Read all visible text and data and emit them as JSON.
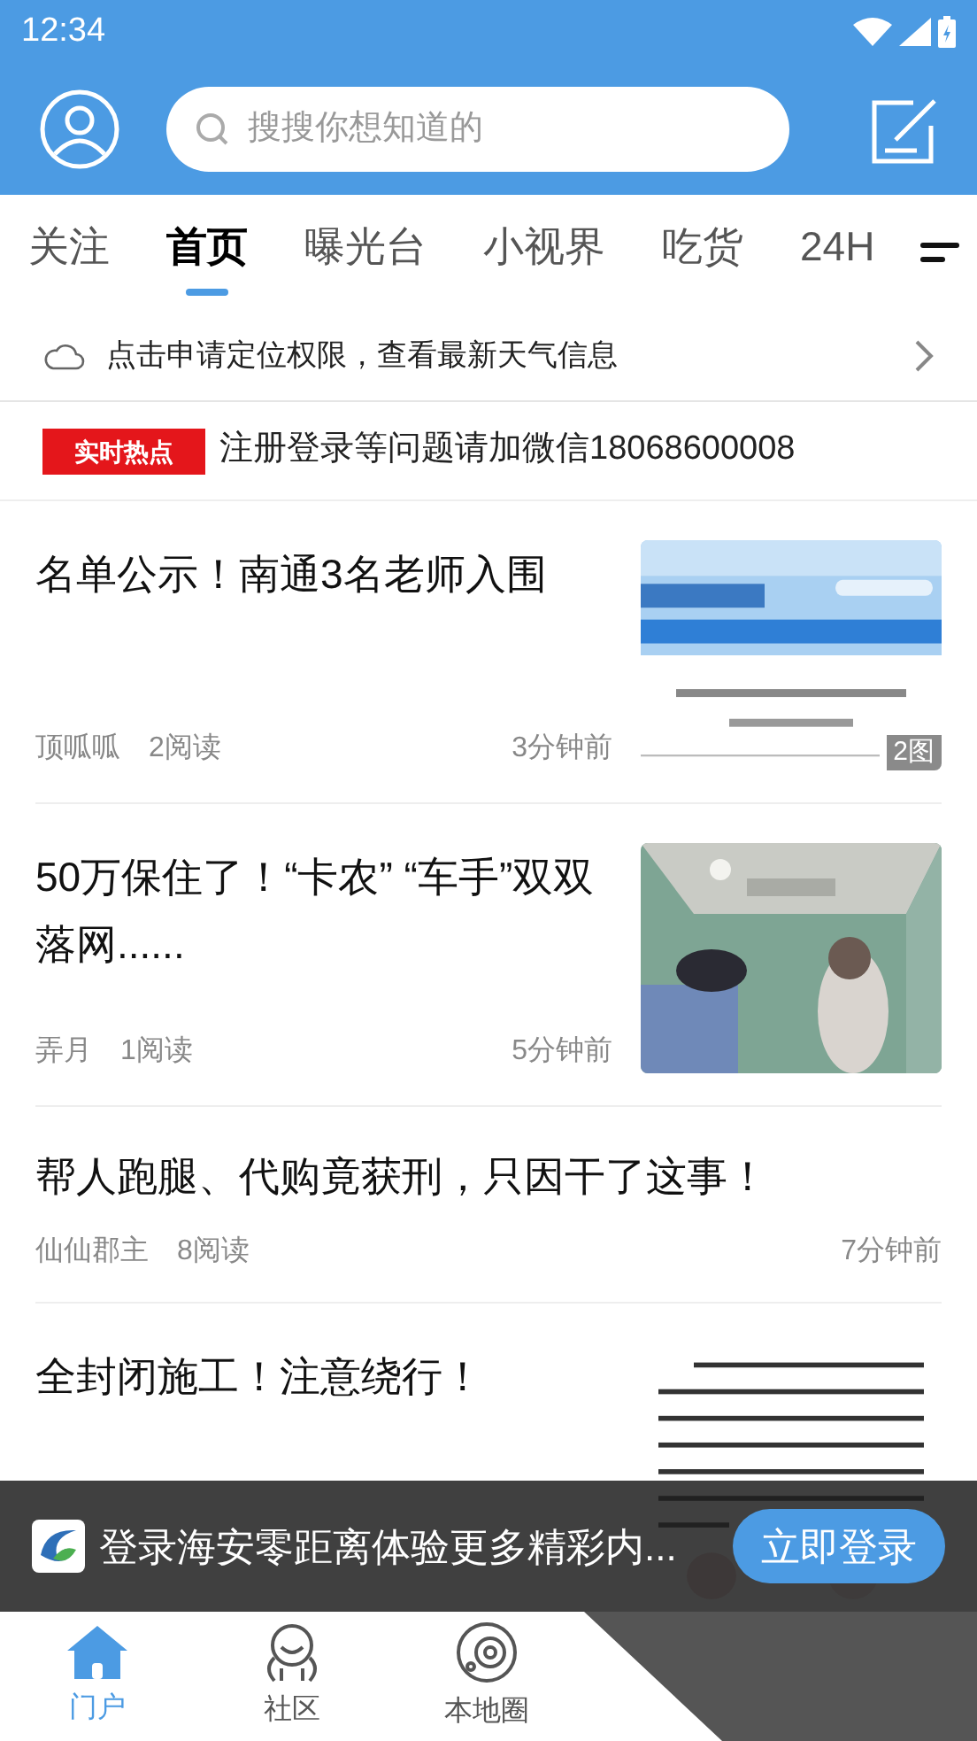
{
  "status_bar": {
    "time": "12:34"
  },
  "header": {
    "search": {
      "placeholder": "搜搜你想知道的"
    }
  },
  "tabs": [
    {
      "label": "关注",
      "selected": false
    },
    {
      "label": "首页",
      "selected": true
    },
    {
      "label": "曝光台",
      "selected": false
    },
    {
      "label": "小视界",
      "selected": false
    },
    {
      "label": "吃货",
      "selected": false
    },
    {
      "label": "24H",
      "selected": false
    }
  ],
  "weather_banner": {
    "text": "点击申请定位权限，查看最新天气信息"
  },
  "hot_notice": {
    "badge": "实时热点",
    "text": "注册登录等问题请加微信18068600008"
  },
  "articles": [
    {
      "title": "名单公示！南通3名老师入围",
      "author": "顶呱呱",
      "reads": "2阅读",
      "time": "3分钟前",
      "thumbnail": {
        "kind": "picture",
        "image_count": "2图"
      }
    },
    {
      "title": "50万保住了！“卡农” “车手”双双落网......",
      "author": "弄月",
      "reads": "1阅读",
      "time": "5分钟前"
    },
    {
      "title": "帮人跑腿、代购竟获刑，只因干了这事！",
      "author": "仙仙郡主",
      "reads": "8阅读",
      "time": "7分钟前"
    },
    {
      "title": "全封闭施工！注意绕行！"
    }
  ],
  "login_prompt": {
    "text": "登录海安零距离体验更多精彩内...",
    "button": "立即登录"
  },
  "bottom_nav": [
    {
      "label": "门户",
      "selected": true
    },
    {
      "label": "社区",
      "selected": false
    },
    {
      "label": "本地圈",
      "selected": false
    }
  ]
}
